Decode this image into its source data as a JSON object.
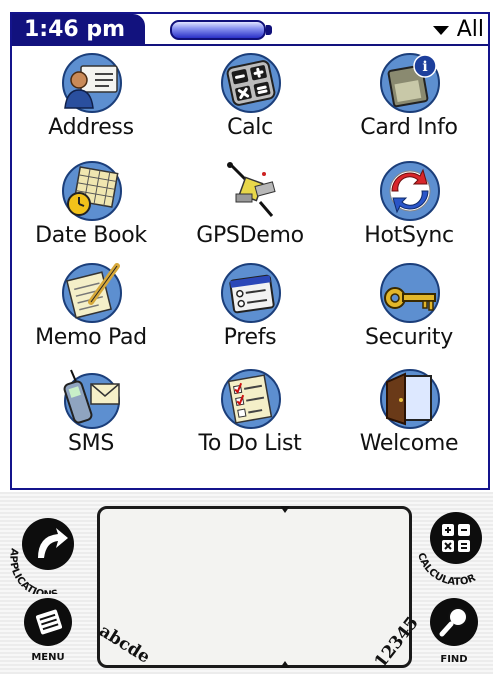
{
  "statusbar": {
    "time": "1:46 pm",
    "category": "All"
  },
  "apps": [
    {
      "label": "Address",
      "icon": "address-icon"
    },
    {
      "label": "Calc",
      "icon": "calculator-icon"
    },
    {
      "label": "Card Info",
      "icon": "card-info-icon"
    },
    {
      "label": "Date Book",
      "icon": "datebook-icon"
    },
    {
      "label": "GPSDemo",
      "icon": "gps-icon"
    },
    {
      "label": "HotSync",
      "icon": "hotsync-icon"
    },
    {
      "label": "Memo Pad",
      "icon": "memopad-icon"
    },
    {
      "label": "Prefs",
      "icon": "prefs-icon"
    },
    {
      "label": "Security",
      "icon": "key-icon"
    },
    {
      "label": "SMS",
      "icon": "phone-mail-icon"
    },
    {
      "label": "To Do List",
      "icon": "todo-icon"
    },
    {
      "label": "Welcome",
      "icon": "door-icon"
    }
  ],
  "silkscreen": {
    "applications": "APPLICATIONS",
    "menu": "MENU",
    "calculator": "CALCULATOR",
    "find": "FIND",
    "graffiti_letters": "abcde",
    "graffiti_numbers": "12345"
  }
}
